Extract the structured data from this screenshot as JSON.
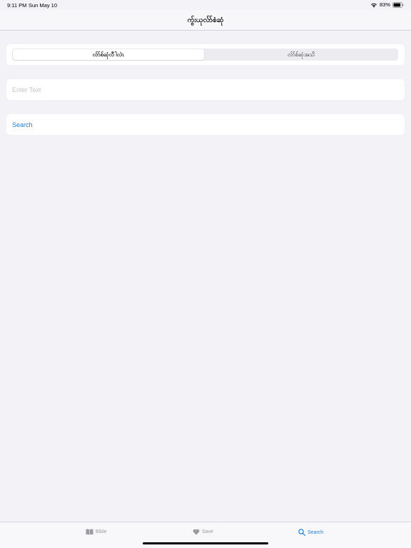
{
  "status_bar": {
    "time": "9:11 PM",
    "date": "Sun May 10",
    "battery": "83%"
  },
  "nav": {
    "title": "ကွ်းယုလ်ာ်စံဆုံ"
  },
  "segments": {
    "left_label": "လ်ာ်စ်ဆုံလီါလဲၤ",
    "right_label": "လ်ာ်စ်ဆုံအသိ",
    "selected": "left"
  },
  "input": {
    "placeholder": "Enter Text",
    "value": ""
  },
  "search_button": {
    "label": "Search"
  },
  "tab_bar": {
    "tabs": [
      {
        "label": "Bible",
        "icon": "book-icon",
        "selected": false
      },
      {
        "label": "Save",
        "icon": "heart-icon",
        "selected": false
      },
      {
        "label": "Search",
        "icon": "search-icon",
        "selected": true
      }
    ]
  },
  "colors": {
    "accent": "#1a7fd4",
    "background": "#f2f2f7"
  }
}
